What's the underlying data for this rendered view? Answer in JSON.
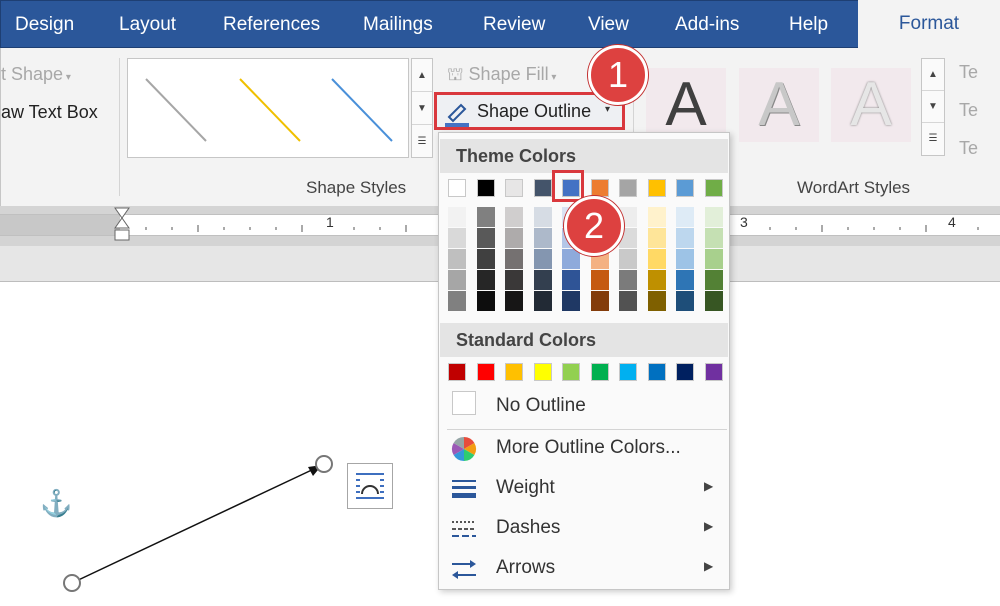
{
  "tabs": {
    "items": [
      {
        "label": "Design"
      },
      {
        "label": "Layout"
      },
      {
        "label": "References"
      },
      {
        "label": "Mailings"
      },
      {
        "label": "Review"
      },
      {
        "label": "View"
      },
      {
        "label": "Add-ins"
      },
      {
        "label": "Help"
      }
    ],
    "active": "Format"
  },
  "ribbon": {
    "insert_shape_partial": "t Shape",
    "draw_text_box_partial": "aw Text Box",
    "shape_fill": "Shape Fill",
    "shape_outline": "Shape Outline",
    "shape_styles_label": "Shape Styles",
    "wordart_styles_label": "WordArt Styles",
    "wordart_letter": "A",
    "text_partial": "Te",
    "gallery_line_colors": [
      "#a6a6a6",
      "#f0c000",
      "#4a90d9"
    ]
  },
  "ruler": {
    "numbers": [
      "1",
      "3",
      "4"
    ]
  },
  "dropdown": {
    "theme_colors_label": "Theme Colors",
    "standard_colors_label": "Standard Colors",
    "theme_row": [
      "#ffffff",
      "#000000",
      "#e7e6e6",
      "#44546a",
      "#4472c4",
      "#ed7d31",
      "#a5a5a5",
      "#ffc000",
      "#5b9bd5",
      "#70ad47"
    ],
    "shades": [
      [
        "#f2f2f2",
        "#d9d9d9",
        "#bfbfbf",
        "#a6a6a6",
        "#808080"
      ],
      [
        "#808080",
        "#595959",
        "#404040",
        "#262626",
        "#0d0d0d"
      ],
      [
        "#d0cece",
        "#aeabab",
        "#757171",
        "#3a3838",
        "#171616"
      ],
      [
        "#d6dce4",
        "#adb9ca",
        "#8496b0",
        "#333f4f",
        "#222a35"
      ],
      [
        "#d9e2f3",
        "#b4c6e7",
        "#8eaadb",
        "#2f5496",
        "#1f3864"
      ],
      [
        "#fbe5d5",
        "#f7cbac",
        "#f4b183",
        "#c55a11",
        "#833c0b"
      ],
      [
        "#ededed",
        "#dbdbdb",
        "#c9c9c9",
        "#7b7b7b",
        "#525252"
      ],
      [
        "#fff2cc",
        "#fee599",
        "#ffd965",
        "#bf9000",
        "#7f6000"
      ],
      [
        "#deebf6",
        "#bdd7ee",
        "#9dc3e6",
        "#2e75b5",
        "#1e4e79"
      ],
      [
        "#e2efd9",
        "#c5e0b3",
        "#a8d08d",
        "#538135",
        "#375623"
      ]
    ],
    "standard": [
      "#c00000",
      "#ff0000",
      "#ffc000",
      "#ffff00",
      "#92d050",
      "#00b050",
      "#00b0f0",
      "#0070c0",
      "#002060",
      "#7030a0"
    ],
    "no_outline": "No Outline",
    "more_colors": "More Outline Colors...",
    "weight": "Weight",
    "dashes": "Dashes",
    "arrows": "Arrows"
  },
  "callouts": {
    "one": "1",
    "two": "2"
  }
}
